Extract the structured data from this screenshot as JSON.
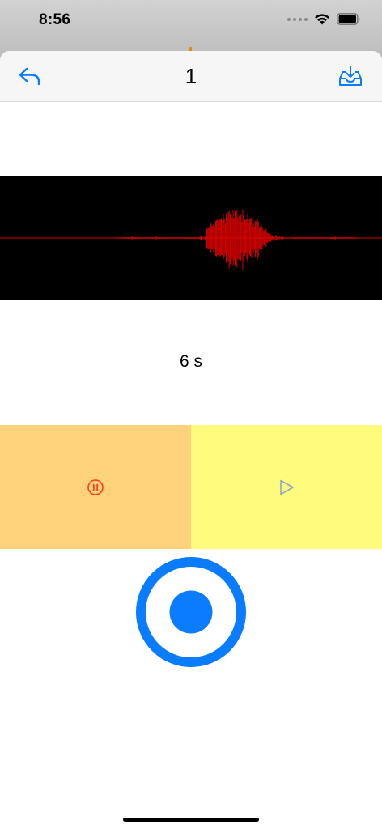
{
  "status_bar": {
    "time": "8:56",
    "icons": [
      "signal-dots-icon",
      "wifi-icon",
      "battery-icon"
    ]
  },
  "nav": {
    "title": "1",
    "back_icon": "undo-arrow-icon",
    "save_icon": "tray-download-icon"
  },
  "recording": {
    "duration": "6 s"
  },
  "controls": {
    "pause_icon": "pause-circle-icon",
    "play_icon": "play-outline-icon",
    "record_icon": "record-button-icon"
  },
  "colors": {
    "accent": "#0a7cff",
    "waveform_bg": "#000000",
    "waveform": "#e00000",
    "pause_bg": "#ffd27c",
    "pause_icon": "#ff3b1f",
    "play_bg": "#fffb7d",
    "play_icon": "#8fa9c8",
    "nav_bg": "#f6f6f7"
  }
}
